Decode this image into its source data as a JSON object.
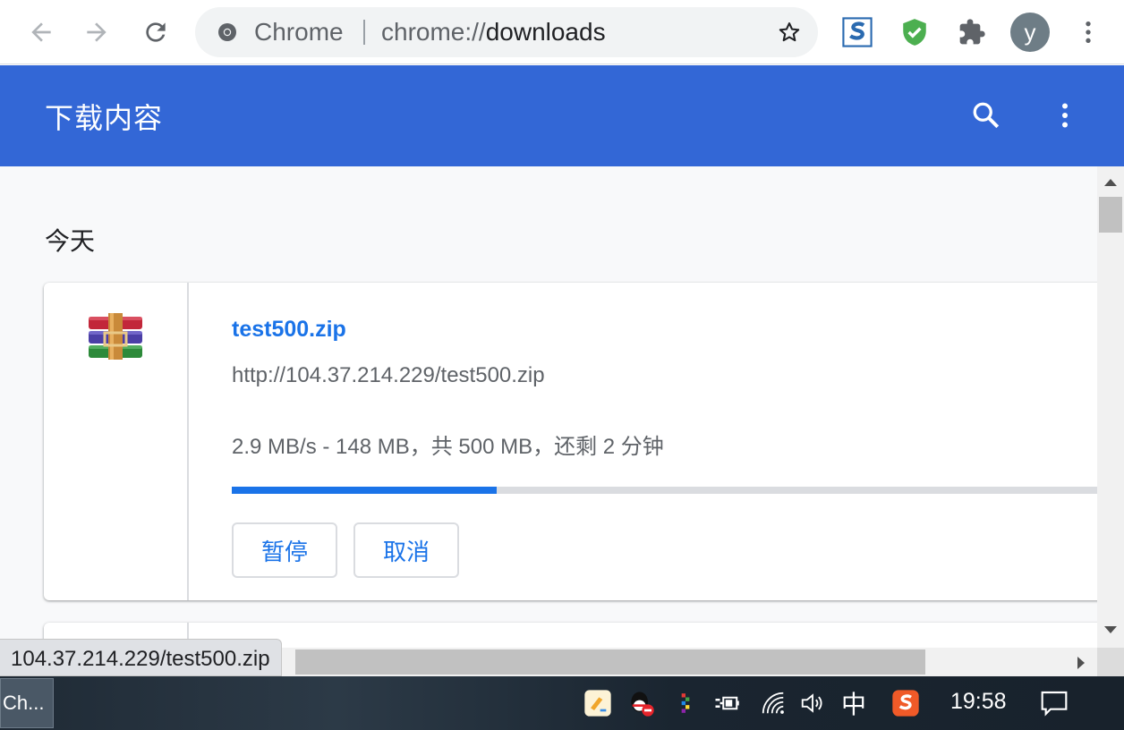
{
  "toolbar": {
    "omnibox_chip": "Chrome",
    "url_scheme": "chrome://",
    "url_path": "downloads",
    "avatar_letter": "y"
  },
  "header": {
    "title": "下载内容",
    "color": "#3367d6"
  },
  "main": {
    "date_heading": "今天",
    "download": {
      "file_name": "test500.zip",
      "url": "http://104.37.214.229/test500.zip",
      "status": "2.9 MB/s - 148 MB，共 500 MB，还剩 2 分钟",
      "progress_fraction": 0.296,
      "pause_label": "暂停",
      "cancel_label": "取消"
    }
  },
  "status_bubble": "104.37.214.229/test500.zip",
  "taskbar": {
    "app_label": "Ch...",
    "ime": "中",
    "clock": "19:58"
  },
  "icons": [
    "back-icon",
    "forward-icon",
    "reload-icon",
    "chrome-icon",
    "star-icon",
    "sogou-ext-icon",
    "shield-ext-icon",
    "extensions-icon",
    "more-icon",
    "search-icon",
    "winrar-icon"
  ]
}
